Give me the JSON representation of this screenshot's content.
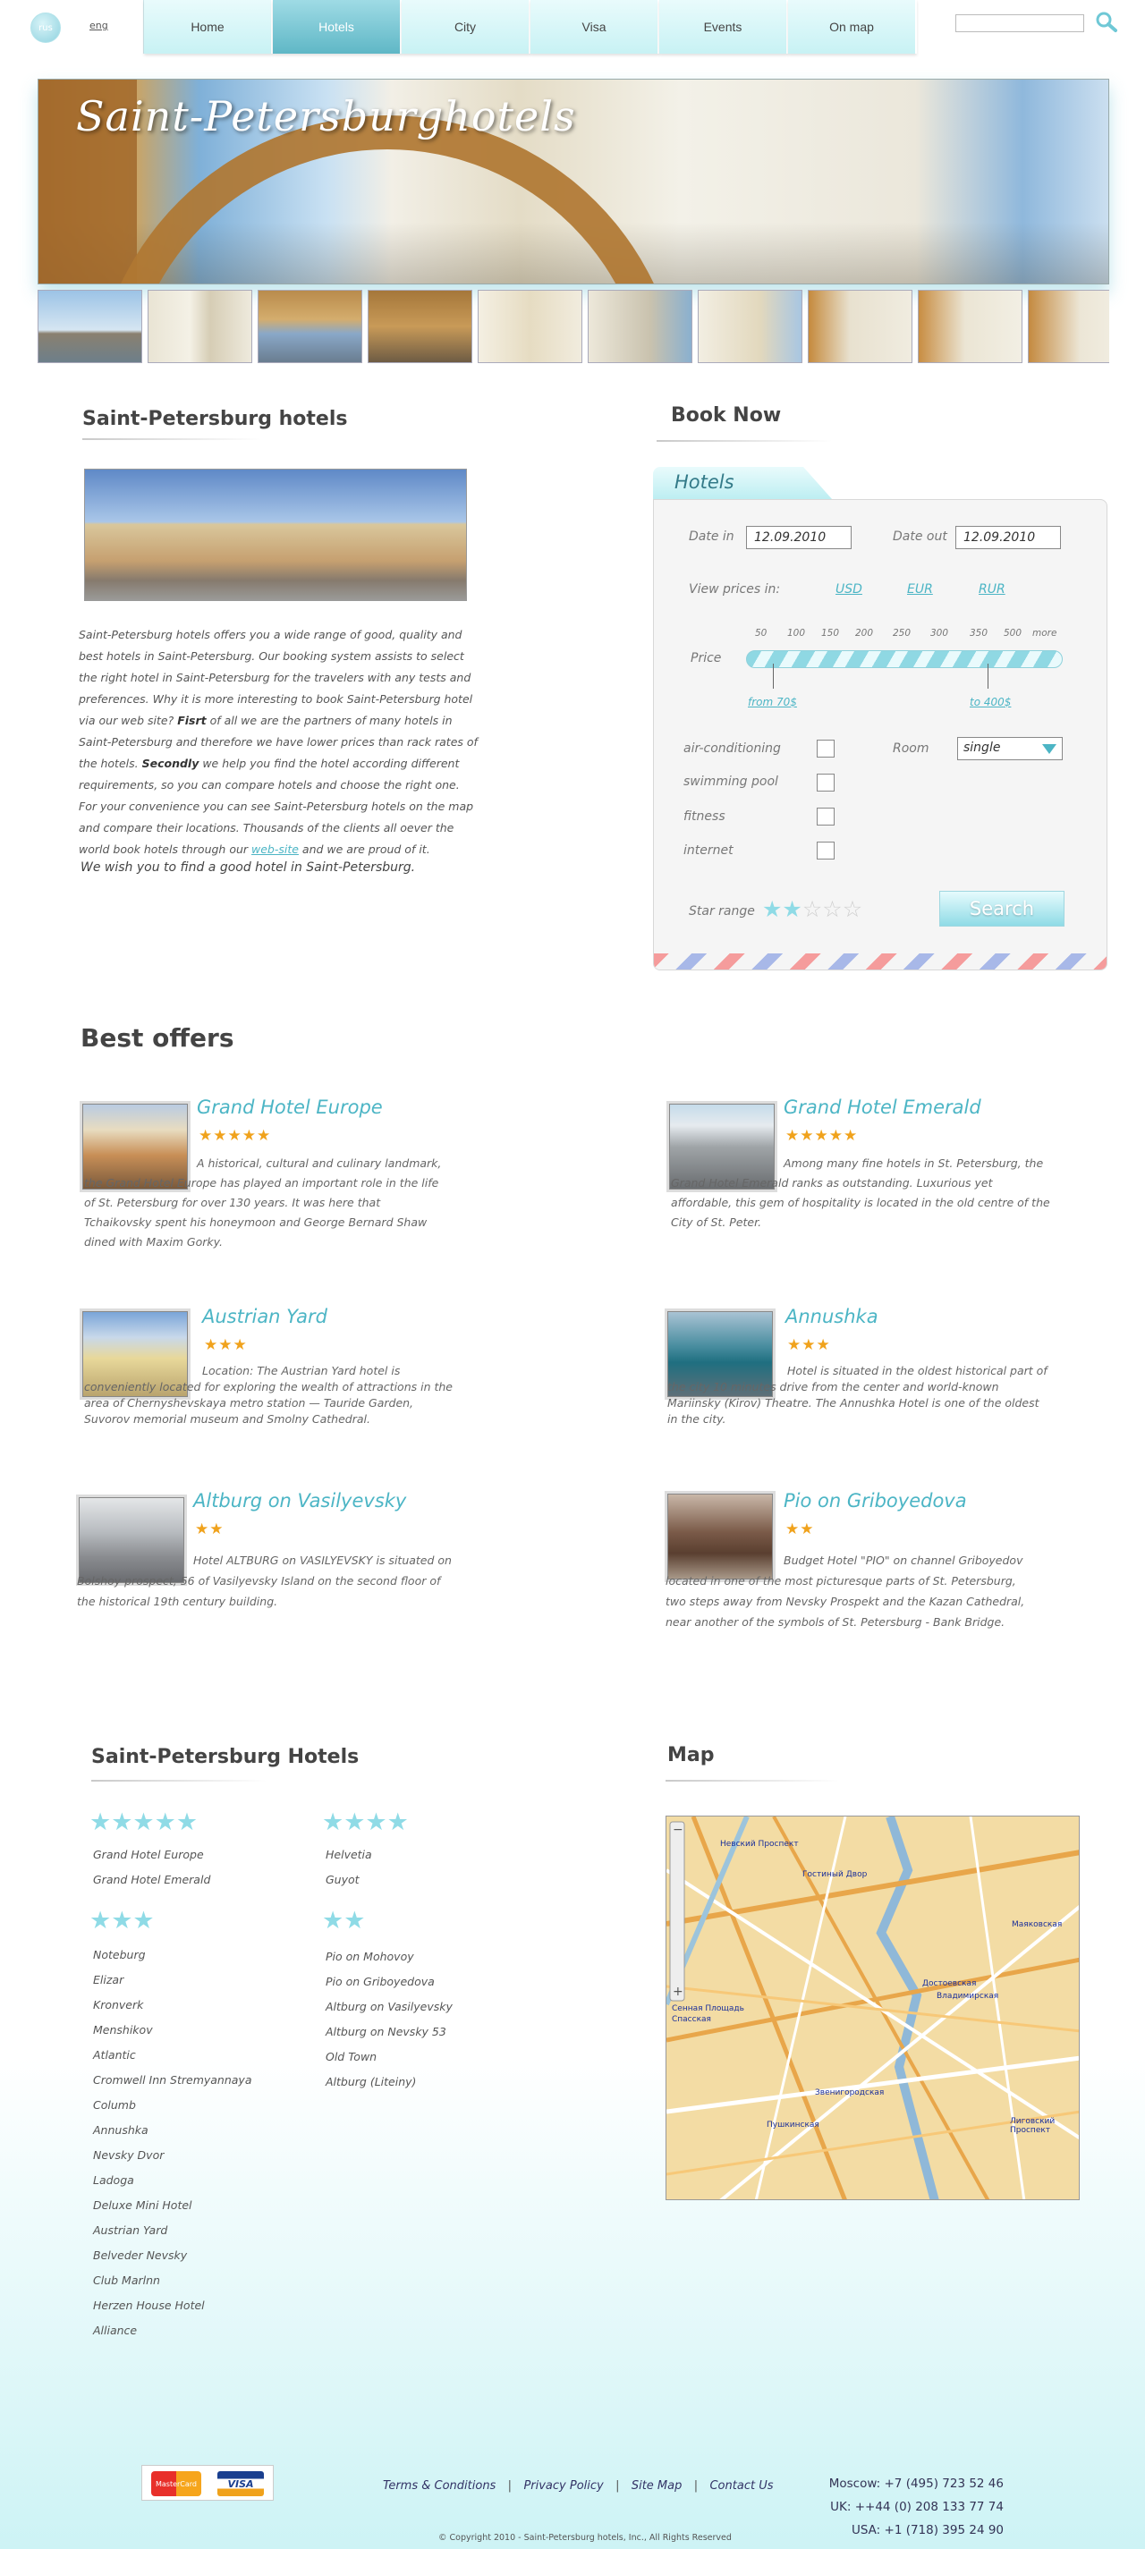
{
  "header": {
    "lang_circle": "rus",
    "lang_alt": "eng",
    "nav": [
      "Home",
      "Hotels",
      "City",
      "Visa",
      "Events",
      "On map"
    ],
    "active_nav": 1,
    "search_placeholder": ""
  },
  "banner": {
    "title": "Saint-Petersburghotels"
  },
  "intro": {
    "title": "Saint-Petersburg hotels",
    "p1": "Saint-Petersburg hotels offers you a wide range of good, quality and best hotels in Saint-Petersburg. Our booking system assists to select the right hotel in Saint-Petersburg for the travelers with any tests and preferences. Why it is more interesting to book Saint-Petersburg hotel via our web site? ",
    "p1_bold": "Fisrt",
    "p2": " of all we are the partners of many hotels in Saint-Petersburg and therefore we have lower prices than rack rates of the hotels. ",
    "p2_bold": "Secondly",
    "p3": " we help you find the hotel according different requirements, so you can compare hotels and choose the right one. For your convenience you can see Saint-Petersburg hotels on the map and compare their locations. Thousands of the clients all oever the world book hotels through our ",
    "p3_link": "web-site",
    "p4": " and we are proud of it.",
    "wish": "We wish you to find a good hotel in Saint-Petersburg."
  },
  "booking": {
    "title": "Book Now",
    "tab": "Hotels",
    "date_in_label": "Date in",
    "date_in_value": "12.09.2010",
    "date_out_label": "Date out",
    "date_out_value": "12.09.2010",
    "view_prices_label": "View prices in:",
    "currencies": [
      "USD",
      "EUR",
      "RUR"
    ],
    "price_label": "Price",
    "scale": [
      "50",
      "100",
      "150",
      "200",
      "250",
      "300",
      "350",
      "500",
      "more"
    ],
    "from_label": "from 70$",
    "to_label": "to 400$",
    "amenities": [
      "air-conditioning",
      "swimming pool",
      "fitness",
      "internet"
    ],
    "room_label": "Room",
    "room_value": "single",
    "star_range_label": "Star range",
    "star_range_value": 2,
    "search_label": "Search"
  },
  "offers": {
    "title": "Best offers",
    "items": [
      {
        "name": "Grand Hotel Europe",
        "stars": "★★★★★",
        "desc": "A historical, cultural and culinary landmark, the Grand Hotel Europe has played an important role in the life of St. Petersburg for over 130 years. It was here that Tchaikovsky spent his honeymoon and George Bernard Shaw dined with Maxim Gorky."
      },
      {
        "name": "Grand Hotel Emerald",
        "stars": "★★★★★",
        "desc": "Among many fine hotels in St. Petersburg, the Grand Hotel Emerald ranks as outstanding. Luxurious yet affordable, this gem of hospitality is located in the old centre of the City of St. Peter."
      },
      {
        "name": "Austrian Yard",
        "stars": "★★★",
        "desc": "Location: The Austrian Yard hotel is conveniently located for exploring the wealth of attractions in the area of Chernyshevskaya metro station — Tauride Garden, Suvorov memorial museum and Smolny Cathedral."
      },
      {
        "name": "Annushka",
        "stars": "★★★",
        "desc": "Hotel is situated in the oldest historical part of the city 10 minutes drive from the center and world-known Mariinsky (Kirov) Theatre. The Annushka Hotel is one of the oldest in the city."
      },
      {
        "name": "Altburg on Vasilyevsky",
        "stars": "★★",
        "desc": "Hotel ALTBURG on VASILYEVSKY is situated on Bolshoy prospect, 56 of Vasilyevsky Island on the second floor of the historical 19th century building."
      },
      {
        "name": "Pio on Griboyedova",
        "stars": "★★",
        "desc": "Budget Hotel \"PIO\" on channel Griboyedov located in one of the most picturesque parts of St. Petersburg, two steps away from Nevsky Prospekt and the Kazan Cathedral, near another of the symbols of St. Petersburg - Bank Bridge."
      }
    ]
  },
  "hotels_list": {
    "title": "Saint-Petersburg Hotels",
    "five_stars": "★★★★★",
    "five": [
      "Grand Hotel Europe",
      "Grand Hotel Emerald"
    ],
    "four_stars": "★★★★",
    "four": [
      "Helvetia",
      "Guyot"
    ],
    "three_stars": "★★★",
    "three": [
      "Noteburg",
      "Elizar",
      "Kronverk",
      "Menshikov",
      "Atlantic",
      "Cromwell Inn Stremyannaya",
      "Columb",
      "Annushka",
      "Nevsky Dvor",
      "Ladoga",
      "Deluxe Mini Hotel",
      "Austrian Yard",
      "Belveder Nevsky",
      "Club Marlnn",
      "Herzen House Hotel",
      "Alliance"
    ],
    "two_stars": "★★",
    "two": [
      "Pio on Mohovoy",
      "Pio on Griboyedova",
      "Altburg on Vasilyevsky",
      "Altburg on Nevsky 53",
      "Old Town",
      "Altburg (Liteiny)"
    ]
  },
  "map": {
    "title": "Map",
    "labels": [
      "Невский Проспект",
      "Гостиный Двор",
      "Маяковская",
      "Достоевская",
      "Владимирская",
      "Сенная Площадь",
      "Спасская",
      "Звенигородская",
      "Пушкинская",
      "Лиговский Проспект"
    ]
  },
  "footer": {
    "links": [
      "Terms & Conditions",
      "Privacy Policy",
      "Site Map",
      "Contact Us"
    ],
    "phones": [
      "Moscow: +7 (495) 723 52 46",
      "UK: ++44 (0) 208 133 77 74",
      "USA: +1 (718) 395 24 90"
    ],
    "copyright": "© Copyright 2010 - Saint-Petersburg hotels, Inc., All Rights Reserved",
    "cards": [
      "MasterCard",
      "VISA"
    ]
  },
  "colors": {
    "accent": "#4cb5c5",
    "nav_active": "#6fbfcc",
    "star_gold": "#f0a21c",
    "star_light": "#8fdbe6"
  }
}
